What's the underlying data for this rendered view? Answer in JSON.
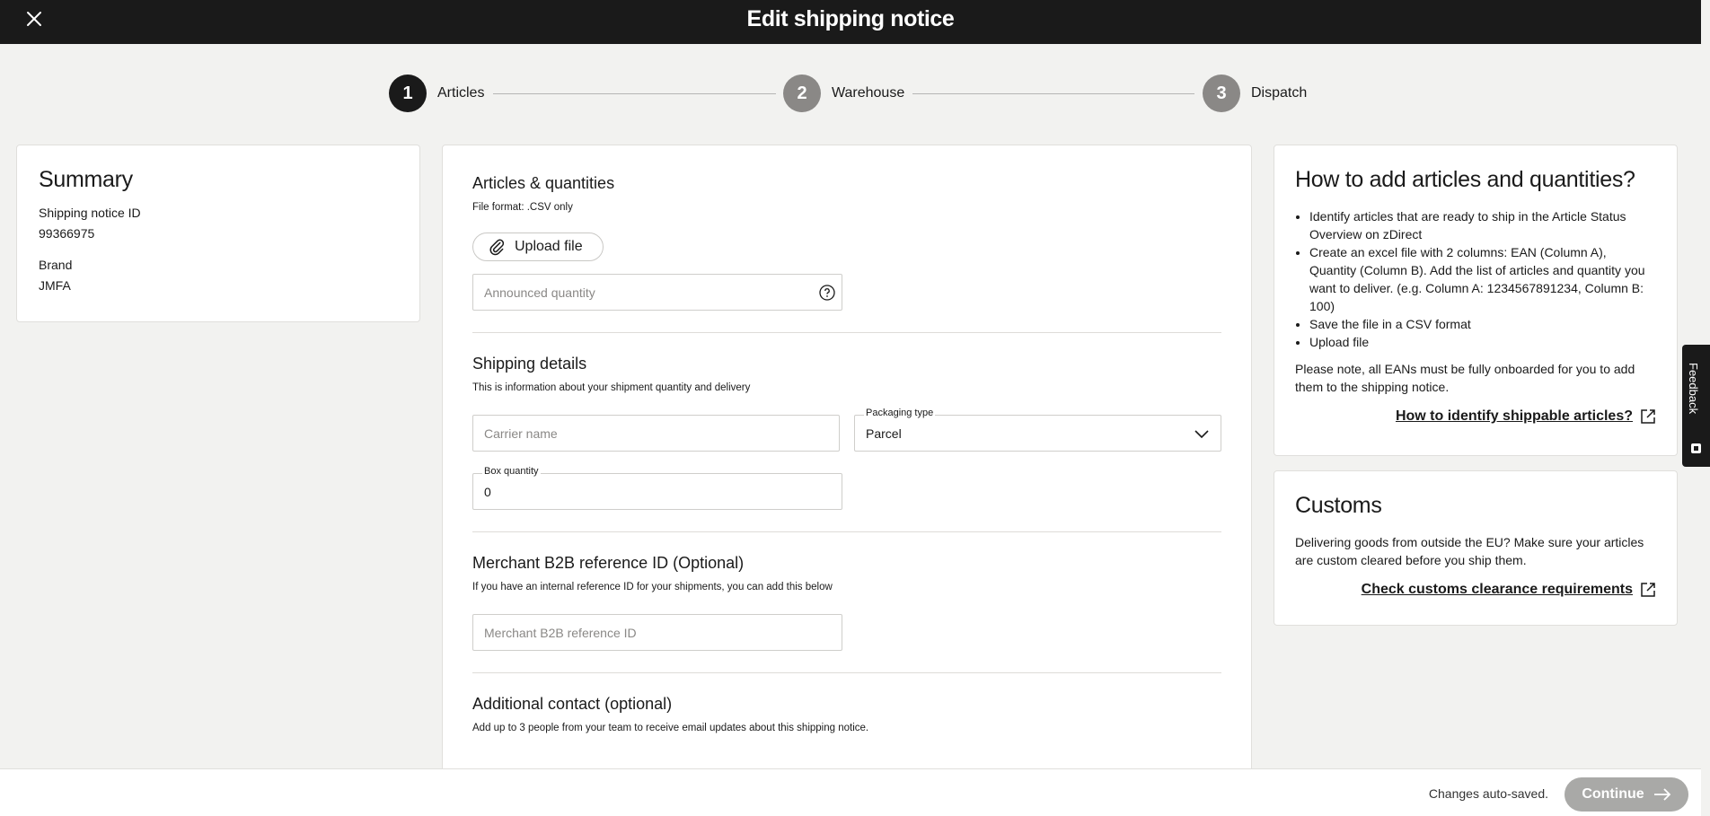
{
  "header": {
    "title": "Edit shipping notice",
    "close_icon": "close-icon"
  },
  "stepper": [
    {
      "number": "1",
      "label": "Articles",
      "state": "active"
    },
    {
      "number": "2",
      "label": "Warehouse",
      "state": "inactive"
    },
    {
      "number": "3",
      "label": "Dispatch",
      "state": "inactive"
    }
  ],
  "summary": {
    "title": "Summary",
    "shipping_notice_id_label": "Shipping notice ID",
    "shipping_notice_id_value": "99366975",
    "brand_label": "Brand",
    "brand_value": "JMFA"
  },
  "articles": {
    "title": "Articles & quantities",
    "subtitle": "File format: .CSV only",
    "upload_label": "Upload file",
    "announced_quantity_placeholder": "Announced quantity"
  },
  "shipping": {
    "title": "Shipping details",
    "subtitle": "This is information about your shipment quantity and delivery",
    "carrier_placeholder": "Carrier name",
    "packaging_label": "Packaging type",
    "packaging_value": "Parcel",
    "box_quantity_label": "Box quantity",
    "box_quantity_value": "0"
  },
  "merchant": {
    "title": "Merchant B2B reference ID (Optional)",
    "subtitle": "If you have an internal reference ID for your shipments, you can add this below",
    "placeholder": "Merchant B2B reference ID"
  },
  "contact": {
    "title": "Additional contact (optional)",
    "subtitle": "Add up to 3 people from your team to receive email updates about this shipping notice."
  },
  "howto": {
    "title": "How to add articles and quantities?",
    "bullets": [
      "Identify articles that are ready to ship in the Article Status Overview on zDirect",
      "Create an excel file with 2 columns: EAN (Column A), Quantity (Column B). Add the list of articles and quantity you want to deliver. (e.g. Column A: 1234567891234, Column B: 100)",
      "Save the file in a CSV format",
      "Upload file"
    ],
    "note": "Please note, all EANs must be fully onboarded for you to add them to the shipping notice.",
    "link": "How to identify shippable articles?"
  },
  "customs": {
    "title": "Customs",
    "text": "Delivering goods from outside the EU? Make sure your articles are custom cleared before you ship them.",
    "link": "Check customs clearance requirements"
  },
  "feedback": {
    "label": "Feedback"
  },
  "footer": {
    "autosave": "Changes auto-saved.",
    "continue_label": "Continue"
  }
}
